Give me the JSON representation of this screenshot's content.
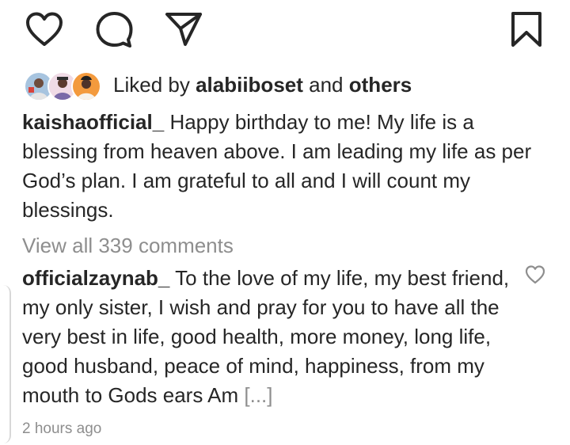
{
  "actions": {
    "like_icon": "heart-outline-icon",
    "comment_icon": "speech-bubble-icon",
    "share_icon": "paper-plane-icon",
    "save_icon": "bookmark-icon"
  },
  "likes": {
    "prefix": "Liked by",
    "user": "alabiiboset",
    "connector": "and",
    "others": "others"
  },
  "caption": {
    "username": "kaishaofficial_",
    "text": "Happy birthday to me! My life is a blessing from heaven above. I am leading my life as per God’s plan. I am grateful to all and I will count my blessings."
  },
  "view_all_comments": "View all 339 comments",
  "comment": {
    "username": "officialzaynab_",
    "text": "To the love of my life, my best friend, my only sister, I wish and pray for you to have all the  very best in life, good health, more money, long life, good husband, peace of mind, happiness, from my mouth to Gods ears Am",
    "more": "[...]",
    "like_icon": "heart-outline-icon"
  },
  "timestamp": "2 hours ago",
  "colors": {
    "text": "#262626",
    "secondary": "#8e8e8e",
    "background": "#ffffff"
  }
}
